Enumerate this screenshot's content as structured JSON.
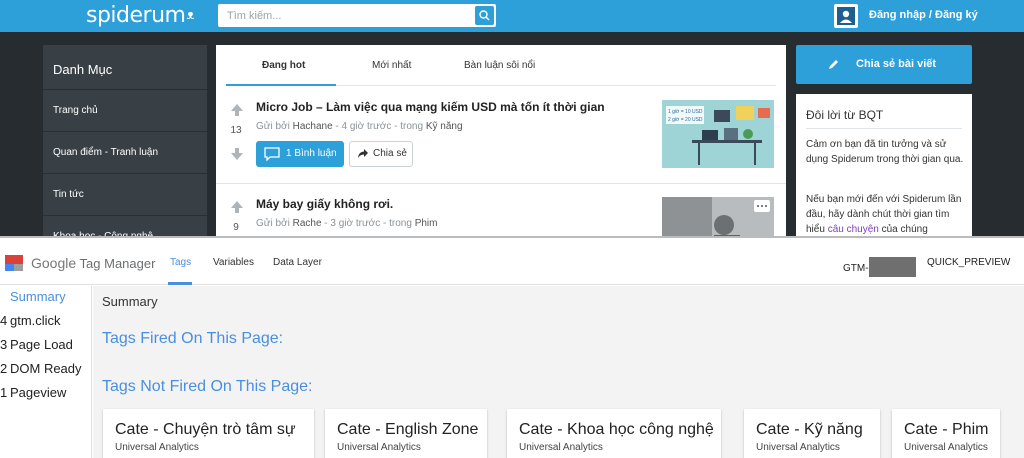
{
  "site": {
    "logo": "spiderum",
    "search_placeholder": "Tìm kiếm...",
    "login": "Đăng nhập / Đăng ký",
    "categories": {
      "title": "Danh Mục",
      "items": [
        "Trang chủ",
        "Quan điểm - Tranh luận",
        "Tin tức",
        "Khoa học - Công nghệ"
      ]
    },
    "tabs": [
      "Đang hot",
      "Mới nhất",
      "Bàn luận sôi nổi"
    ],
    "posts": [
      {
        "title": "Micro Job – Làm việc qua mạng kiếm USD mà tốn ít thời gian",
        "meta_prefix": "Gửi bởi",
        "author": "Hachane",
        "meta_time": "- 4 giờ trước - trong",
        "category": "Kỹ năng",
        "votes": "13",
        "comment_label": "1 Bình luận",
        "share_label": "Chia sẻ",
        "thumb_lines": [
          "1 giờ = 10 USD",
          "2 giờ = 20 USD"
        ]
      },
      {
        "title": "Máy bay giấy không rơi.",
        "meta_prefix": "Gửi bởi",
        "author": "Rache",
        "meta_time": "- 3 giờ trước - trong",
        "category": "Phim",
        "votes": "9"
      }
    ],
    "share_post_label": "Chia sẻ bài viết",
    "bqt": {
      "title": "Đôi lời từ BQT",
      "p1": "Cảm ơn bạn đã tin tưởng và sử dụng Spiderum trong thời gian qua.",
      "p2_before": "Nếu bạn mới đến với Spiderum lần đầu, hãy dành chút thời gian tìm hiểu",
      "p2_link": "câu chuyện",
      "p2_after": "của chúng"
    }
  },
  "gtm": {
    "brand_google": "Google",
    "brand_product": "Tag Manager",
    "tabs": [
      "Tags",
      "Variables",
      "Data Layer"
    ],
    "container_prefix": "GTM-",
    "mode": "QUICK_PREVIEW",
    "events": [
      {
        "num": "",
        "label": "Summary"
      },
      {
        "num": "4",
        "label": "gtm.click"
      },
      {
        "num": "3",
        "label": "Page Load"
      },
      {
        "num": "2",
        "label": "DOM Ready"
      },
      {
        "num": "1",
        "label": "Pageview"
      }
    ],
    "summary_title": "Summary",
    "fired_title": "Tags Fired On This Page:",
    "not_fired_title": "Tags Not Fired On This Page:",
    "cards": [
      {
        "name": "Cate - Chuyện trò tâm sự",
        "type": "Universal Analytics"
      },
      {
        "name": "Cate - English Zone",
        "type": "Universal Analytics"
      },
      {
        "name": "Cate - Khoa học công nghệ",
        "type": "Universal Analytics"
      },
      {
        "name": "Cate - Kỹ năng",
        "type": "Universal Analytics"
      },
      {
        "name": "Cate - Phim",
        "type": "Universal Analytics"
      }
    ]
  },
  "colors": {
    "brand_blue": "#2d9fd9",
    "dark_bg": "#262c30",
    "gtm_blue": "#4a8fde"
  }
}
